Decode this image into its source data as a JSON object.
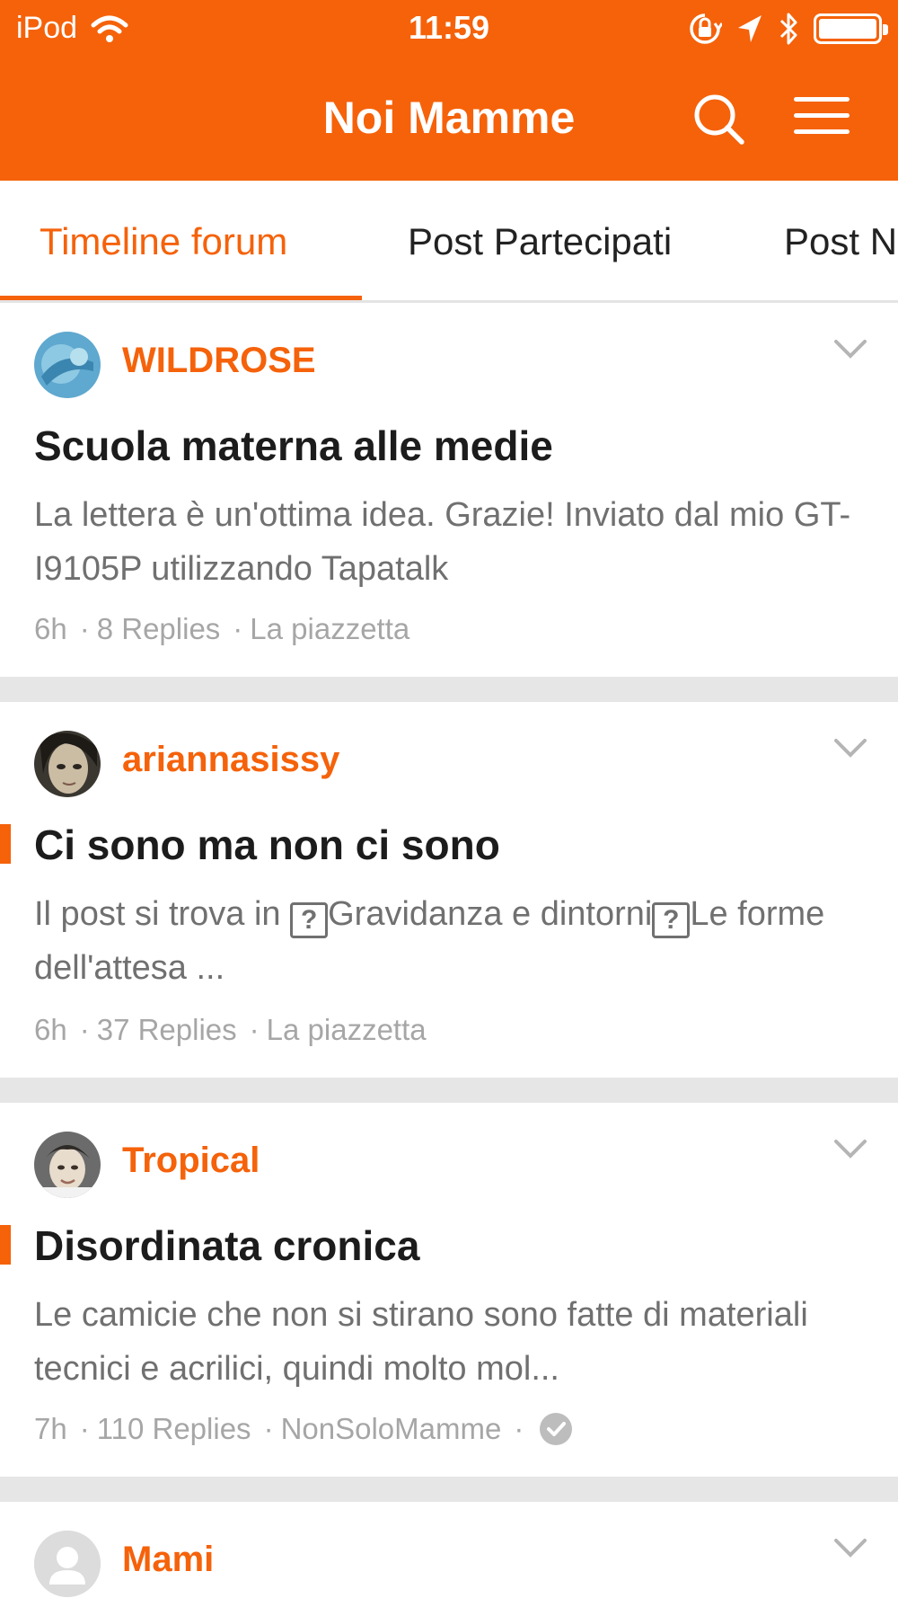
{
  "status_bar": {
    "carrier": "iPod",
    "time": "11:59"
  },
  "nav": {
    "title": "Noi Mamme",
    "search_icon": "search-icon",
    "menu_icon": "hamburger-menu-icon"
  },
  "tabs": [
    {
      "label": "Timeline forum",
      "active": true
    },
    {
      "label": "Post Partecipati",
      "active": false
    },
    {
      "label": "Post N",
      "active": false
    }
  ],
  "colors": {
    "accent": "#f5620a",
    "separator": "#e6e6e6",
    "meta_text": "#a6a6a6",
    "excerpt_text": "#707070"
  },
  "posts": [
    {
      "author": "WILDROSE",
      "title": "Scuola materna alle medie",
      "excerpt": "La lettera è un'ottima idea. Grazie!  Inviato dal mio GT-I9105P utilizzando Tapatalk",
      "time": "6h",
      "replies": "8 Replies",
      "forum": "La piazzetta",
      "unread": false
    },
    {
      "author": "ariannasissy",
      "title": "Ci sono ma non ci sono",
      "excerpt_part1": "Il post si trova in ",
      "excerpt_part2": "Gravidanza e dintorni",
      "excerpt_part3": "Le forme dell'attesa ...",
      "placeholder_glyph": "?",
      "time": "6h",
      "replies": "37 Replies",
      "forum": "La piazzetta",
      "unread": true
    },
    {
      "author": "Tropical",
      "title": "Disordinata cronica",
      "excerpt": "Le camicie che non si stirano sono fatte di materiali tecnici e acrilici, quindi molto mol...",
      "time": "7h",
      "replies": "110 Replies",
      "forum": "NonSoloMamme",
      "unread": true,
      "verified": true
    },
    {
      "author": "Mami"
    }
  ]
}
